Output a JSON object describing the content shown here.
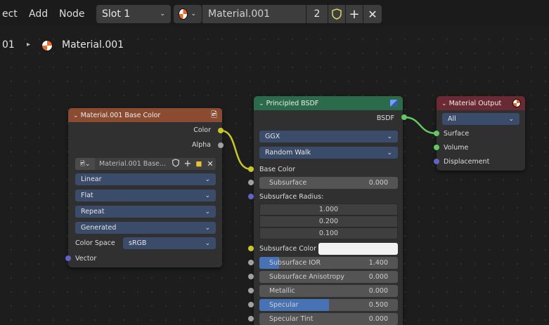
{
  "header": {
    "menu": [
      "ect",
      "Add",
      "Node"
    ],
    "slot": "Slot 1",
    "material_name": "Material.001",
    "users": "2"
  },
  "breadcrumb": {
    "prefix": "01",
    "material": "Material.001"
  },
  "image_node": {
    "title": "Material.001 Base Color",
    "outputs": [
      "Color",
      "Alpha"
    ],
    "image_name": "Material.001 Base...",
    "interpolation": "Linear",
    "projection": "Flat",
    "extension": "Repeat",
    "source": "Generated",
    "color_space_label": "Color Space",
    "color_space": "sRGB",
    "input": "Vector",
    "header_color": "#8a4b30"
  },
  "bsdf_node": {
    "title": "Principled BSDF",
    "output": "BSDF",
    "distribution": "GGX",
    "subsurface_method": "Random Walk",
    "base_color_label": "Base Color",
    "subsurface_label": "Subsurface",
    "subsurface_value": "0.000",
    "subsurface_radius_label": "Subsurface Radius:",
    "radius": [
      "1.000",
      "0.200",
      "0.100"
    ],
    "subsurface_color_label": "Subsurface Color",
    "ior_label": "Subsurface IOR",
    "ior_value": "1.400",
    "ior_fill": 0.14,
    "anisotropy_label": "Subsurface Anisotropy",
    "anisotropy_value": "0.000",
    "metallic_label": "Metallic",
    "metallic_value": "0.000",
    "specular_label": "Specular",
    "specular_value": "0.500",
    "specular_fill": 0.5,
    "specular_tint_label": "Specular Tint",
    "specular_tint_value": "0.000",
    "header_color": "#2b6b4c"
  },
  "output_node": {
    "title": "Material Output",
    "target": "All",
    "inputs": [
      "Surface",
      "Volume",
      "Displacement"
    ],
    "header_color": "#6b2a33"
  }
}
